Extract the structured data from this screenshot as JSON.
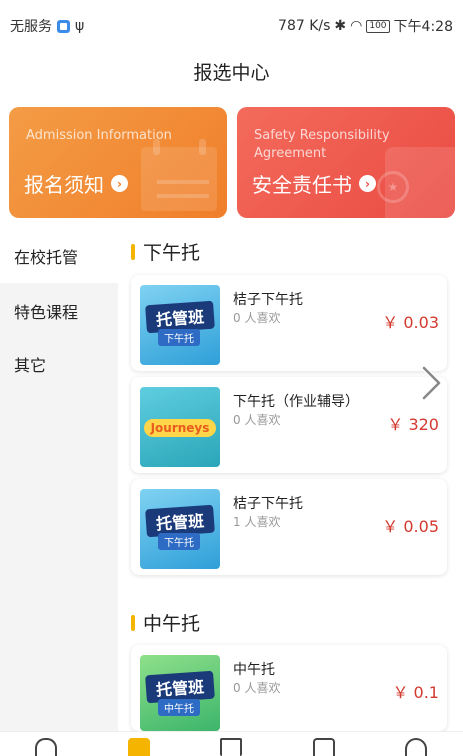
{
  "status": {
    "carrier": "无服务",
    "usb_icon": "ψ",
    "speed": "787 K/s",
    "battery": "100",
    "time": "下午4:28"
  },
  "title": "报选中心",
  "banners": [
    {
      "en": "Admission Information",
      "cn": "报名须知"
    },
    {
      "en": "Safety Responsibility Agreement",
      "cn": "安全责任书"
    }
  ],
  "sidebar": {
    "items": [
      {
        "label": "在校托管"
      },
      {
        "label": "特色课程"
      },
      {
        "label": "其它"
      }
    ]
  },
  "sections": [
    {
      "title": "下午托"
    },
    {
      "title": "中午托"
    }
  ],
  "cards": [
    {
      "title": "桔子下午托",
      "likes": "0 人喜欢",
      "price": "￥ 0.03",
      "badge": "托管班",
      "badge_sub": "下午托"
    },
    {
      "title": "下午托（作业辅导）",
      "likes": "0 人喜欢",
      "price": "￥ 320",
      "badge": "Journeys"
    },
    {
      "title": "桔子下午托",
      "likes": "1 人喜欢",
      "price": "￥ 0.05",
      "badge": "托管班",
      "badge_sub": "下午托"
    },
    {
      "title": "中午托",
      "likes": "0 人喜欢",
      "price": "￥ 0.1",
      "badge": "托管班",
      "badge_sub": "中午托"
    }
  ],
  "colors": {
    "accent": "#f4b400",
    "price": "#d33a2f",
    "banner_orange": "#f07e2a",
    "banner_red": "#ea4a42"
  },
  "icons": {
    "next": "chevron-right-icon",
    "tabs": [
      "home-icon",
      "book-icon",
      "hourglass-icon",
      "message-icon",
      "profile-icon"
    ]
  }
}
